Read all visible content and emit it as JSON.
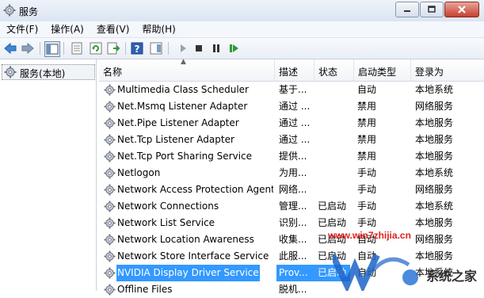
{
  "window": {
    "title": "服务"
  },
  "menu": [
    "文件(F)",
    "操作(A)",
    "查看(V)",
    "帮助(H)"
  ],
  "tree": {
    "root_label": "服务(本地)"
  },
  "columns": {
    "name": "名称",
    "desc": "描述",
    "status": "状态",
    "startup": "启动类型",
    "logon": "登录为"
  },
  "rows": [
    {
      "name": "Multimedia Class Scheduler",
      "desc": "基于...",
      "status": "",
      "startup": "自动",
      "logon": "本地系统"
    },
    {
      "name": "Net.Msmq Listener Adapter",
      "desc": "通过 ...",
      "status": "",
      "startup": "禁用",
      "logon": "网络服务"
    },
    {
      "name": "Net.Pipe Listener Adapter",
      "desc": "通过 ...",
      "status": "",
      "startup": "禁用",
      "logon": "本地服务"
    },
    {
      "name": "Net.Tcp Listener Adapter",
      "desc": "通过 ...",
      "status": "",
      "startup": "禁用",
      "logon": "本地服务"
    },
    {
      "name": "Net.Tcp Port Sharing Service",
      "desc": "提供...",
      "status": "",
      "startup": "禁用",
      "logon": "本地服务"
    },
    {
      "name": "Netlogon",
      "desc": "为用...",
      "status": "",
      "startup": "手动",
      "logon": "本地系统"
    },
    {
      "name": "Network Access Protection Agent",
      "desc": "网络...",
      "status": "",
      "startup": "手动",
      "logon": "网络服务"
    },
    {
      "name": "Network Connections",
      "desc": "管理...",
      "status": "已启动",
      "startup": "手动",
      "logon": "本地系统"
    },
    {
      "name": "Network List Service",
      "desc": "识别...",
      "status": "已启动",
      "startup": "手动",
      "logon": "本地服务"
    },
    {
      "name": "Network Location Awareness",
      "desc": "收集...",
      "status": "已启动",
      "startup": "自动",
      "logon": "网络服务"
    },
    {
      "name": "Network Store Interface Service",
      "desc": "此服...",
      "status": "已启动",
      "startup": "自动",
      "logon": "本地服务"
    },
    {
      "name": "NVIDIA Display Driver Service",
      "desc": "Prov...",
      "status": "已启动",
      "startup": "自动",
      "logon": "本地系统"
    },
    {
      "name": "Offline Files",
      "desc": "脱机...",
      "status": "",
      "startup": "",
      "logon": ""
    }
  ],
  "selected_row": 11,
  "watermark": {
    "site": "www.win7zhijia.cn",
    "logo_text": "系统之家"
  }
}
